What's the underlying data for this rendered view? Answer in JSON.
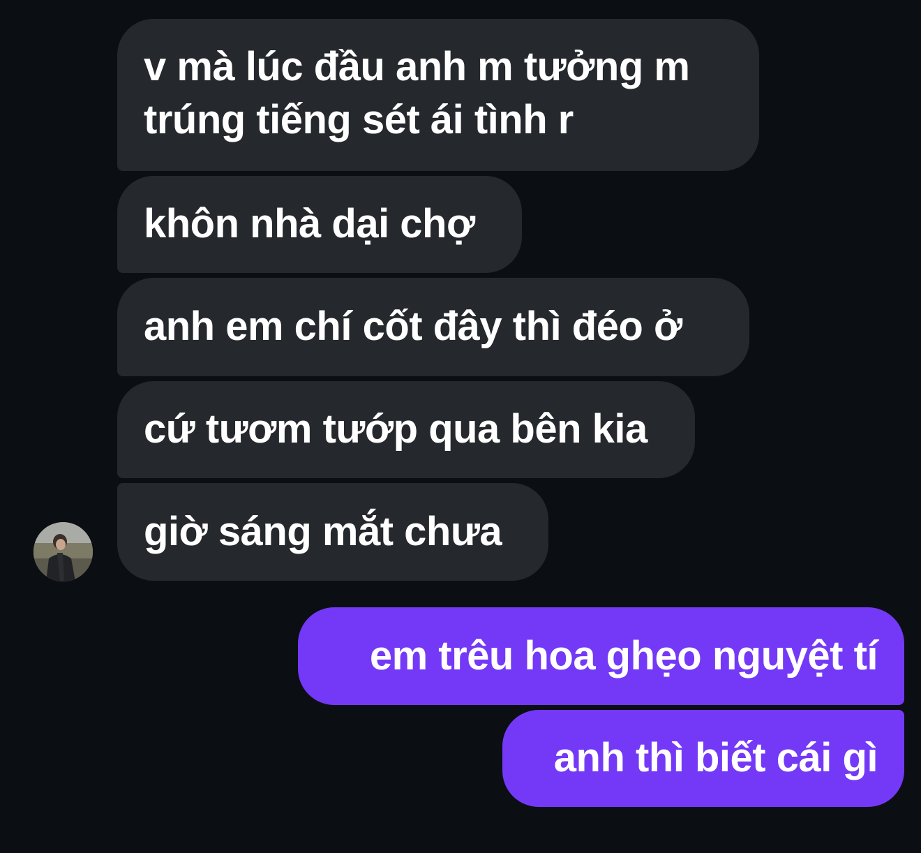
{
  "conversation": {
    "incoming_messages": [
      {
        "text_lines": [
          "v mà lúc đầu anh m tưởng m",
          "trúng tiếng sét ái tình r"
        ]
      },
      {
        "text": "khôn nhà dại chợ"
      },
      {
        "text": "anh em chí cốt đây thì đéo ở"
      },
      {
        "text": "cứ tươm tướp qua bên kia"
      },
      {
        "text": "giờ sáng mắt chưa"
      }
    ],
    "outgoing_messages": [
      {
        "text": "em trêu hoa ghẹo nguyệt tí"
      },
      {
        "text": "anh thì biết cái gì"
      }
    ]
  },
  "colors": {
    "background": "#0b0f13",
    "incoming_bubble": "#25282c",
    "outgoing_bubble": "#7439f7",
    "text": "#ffffff"
  },
  "icons": {
    "contact_avatar": "contact-avatar-photo"
  }
}
